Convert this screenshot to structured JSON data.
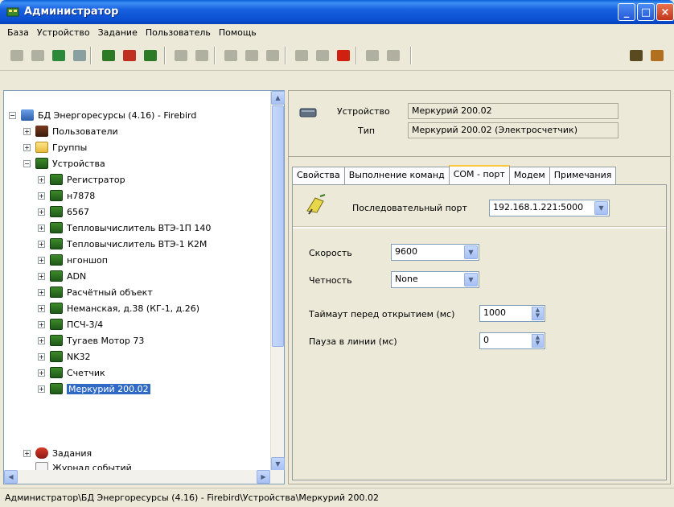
{
  "window": {
    "title": "Администратор"
  },
  "menu": [
    "База",
    "Устройство",
    "Задание",
    "Пользователь",
    "Помощь"
  ],
  "toolbar": {
    "buttons": [
      {
        "icon": "stop-icon",
        "color": "#b0b0a0"
      },
      {
        "icon": "cancel-icon",
        "color": "#b0b0a0"
      },
      {
        "icon": "user-add-icon",
        "color": "#2a8a3a"
      },
      {
        "icon": "user-remove-icon",
        "color": "#8aa0a0"
      },
      {
        "icon": "device-add-icon",
        "color": "#2d7a26"
      },
      {
        "icon": "device-remove-icon",
        "color": "#c03020"
      },
      {
        "icon": "device-edit-icon",
        "color": "#2d7a26"
      },
      {
        "icon": "tool-icon",
        "color": "#b0b0a0"
      },
      {
        "icon": "tool2-icon",
        "color": "#b0b0a0"
      },
      {
        "icon": "play-icon",
        "color": "#b0b0a0"
      },
      {
        "icon": "task-icon",
        "color": "#b0b0a0"
      },
      {
        "icon": "task2-icon",
        "color": "#b0b0a0"
      },
      {
        "icon": "grid-icon",
        "color": "#b0b0a0"
      },
      {
        "icon": "grid2-icon",
        "color": "#b0b0a0"
      },
      {
        "icon": "connect-icon",
        "color": "#d02010"
      },
      {
        "icon": "folder-icon",
        "color": "#b0b0a0"
      },
      {
        "icon": "folder2-icon",
        "color": "#b0b0a0"
      },
      {
        "icon": "security-icon",
        "color": "#5a4a20"
      },
      {
        "icon": "edit-icon",
        "color": "#b07020"
      }
    ]
  },
  "tree": {
    "root": "БД Энергоресурсы (4.16) - Firebird",
    "users": "Пользователи",
    "groups": "Группы",
    "devices": "Устройства",
    "device_items": [
      "Регистратор",
      "н7878",
      "6567",
      "Тепловычислитель ВТЭ-1П 140",
      "Тепловычислитель ВТЭ-1 К2М",
      "нгоншоп",
      "ADN",
      "Расчётный объект",
      "Неманская, д.38 (КГ-1, д.26)",
      "ПСЧ-3/4",
      "Тугаев Мотор 73",
      "NK32",
      "Счетчик",
      "Меркурий 200.02"
    ],
    "tasks": "Задания",
    "log": "Журнал событий"
  },
  "details": {
    "device_label": "Устройство",
    "device_value": "Меркурий 200.02",
    "type_label": "Тип",
    "type_value": "Меркурий 200.02 (Электросчетчик)"
  },
  "tabs": [
    "Свойства",
    "Выполнение команд",
    "COM - порт",
    "Модем",
    "Примечания"
  ],
  "com_port": {
    "serial_label": "Последовательный порт",
    "serial_value": "192.168.1.221:5000",
    "speed_label": "Скорость",
    "speed_value": "9600",
    "parity_label": "Четность",
    "parity_value": "None",
    "timeout_label": "Таймаут перед открытием (мс)",
    "timeout_value": "1000",
    "pause_label": "Пауза в линии (мс)",
    "pause_value": "0"
  },
  "status": "Администратор\\БД Энергоресурсы (4.16) - Firebird\\Устройства\\Меркурий 200.02"
}
